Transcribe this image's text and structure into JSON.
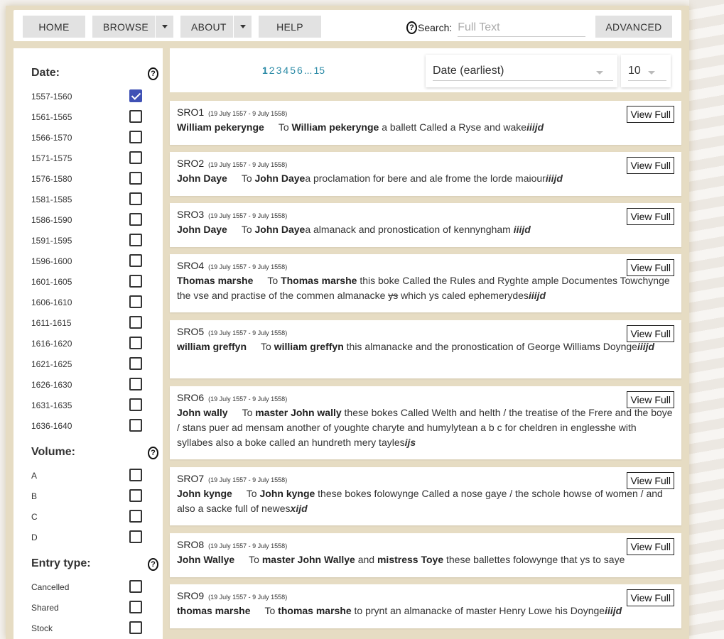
{
  "nav": {
    "home": "HOME",
    "browse": "BROWSE",
    "about": "ABOUT",
    "help": "HELP",
    "help_mark": "?",
    "search_label": "Search:",
    "search_placeholder": "Full Text",
    "advanced": "ADVANCED"
  },
  "filters": {
    "help_mark": "?",
    "date": {
      "title": "Date:",
      "items": [
        {
          "label": "1557-1560",
          "checked": true
        },
        {
          "label": "1561-1565",
          "checked": false
        },
        {
          "label": "1566-1570",
          "checked": false
        },
        {
          "label": "1571-1575",
          "checked": false
        },
        {
          "label": "1576-1580",
          "checked": false
        },
        {
          "label": "1581-1585",
          "checked": false
        },
        {
          "label": "1586-1590",
          "checked": false
        },
        {
          "label": "1591-1595",
          "checked": false
        },
        {
          "label": "1596-1600",
          "checked": false
        },
        {
          "label": "1601-1605",
          "checked": false
        },
        {
          "label": "1606-1610",
          "checked": false
        },
        {
          "label": "1611-1615",
          "checked": false
        },
        {
          "label": "1616-1620",
          "checked": false
        },
        {
          "label": "1621-1625",
          "checked": false
        },
        {
          "label": "1626-1630",
          "checked": false
        },
        {
          "label": "1631-1635",
          "checked": false
        },
        {
          "label": "1636-1640",
          "checked": false
        }
      ]
    },
    "volume": {
      "title": "Volume:",
      "items": [
        {
          "label": "A",
          "checked": false
        },
        {
          "label": "B",
          "checked": false
        },
        {
          "label": "C",
          "checked": false
        },
        {
          "label": "D",
          "checked": false
        }
      ]
    },
    "entry_type": {
      "title": "Entry type:",
      "items": [
        {
          "label": "Cancelled",
          "checked": false
        },
        {
          "label": "Shared",
          "checked": false
        },
        {
          "label": "Stock",
          "checked": false
        }
      ]
    }
  },
  "pager": {
    "pages": [
      "1",
      "2",
      "3",
      "4",
      "5",
      "6",
      "...",
      "15"
    ],
    "current": "1",
    "sort": "Date (earliest)",
    "per_page": "10"
  },
  "results": {
    "view_label": "View Full",
    "items": [
      {
        "id": "SRO1",
        "date": "(19 July 1557 - 9 July 1558)",
        "html": "<b>William pekerynge</b><span class=\"gap\"></span>To <b>William pekerynge</b> a ballett Called a Ryse and wake<span class=\"fee\">iiijd</span>"
      },
      {
        "id": "SRO2",
        "date": "(19 July 1557 - 9 July 1558)",
        "html": "<b>John Daye</b><span class=\"gap\"></span>To <b>John Daye</b>a proclamation for bere and ale frome the lorde maiour<span class=\"fee\">iiijd</span>"
      },
      {
        "id": "SRO3",
        "date": "(19 July 1557 - 9 July 1558)",
        "html": "<b>John Daye</b><span class=\"gap\"></span>To <b>John Daye</b>a almanack and pronostication of kennyngham <span class=\"fee\">iiijd</span>"
      },
      {
        "id": "SRO4",
        "date": "(19 July 1557 - 9 July 1558)",
        "html": "<b>Thomas marshe</b><span class=\"gap\"></span>To <b>Thomas marshe</b> this boke Called the Rules and Ryghte ample Documentes Towchynge the vse and practise of the commen almanacke <span class=\"strike\">ys</span> which ys caled ephemerydes<span class=\"fee\">iiijd</span>"
      },
      {
        "id": "SRO5",
        "date": "(19 July 1557 - 9 July 1558)",
        "html": "<b>william greffyn</b><span class=\"gap\"></span>To <b>william greffyn</b> this almanacke and the pronostication of George Williams Doynge<span class=\"fee\">iiijd</span>"
      },
      {
        "id": "SRO6",
        "date": "(19 July 1557 - 9 July 1558)",
        "html": "<b>John wally</b><span class=\"gap\"></span>To <b>master John wally</b> these bokes Called Welth and helth / the treatise of the Frere and the boye / stans puer ad mensam another of youghte charyte and humylytean a b c for cheldren in englesshe with syllabes also a boke called an hundreth mery tayles<span class=\"fee\">ijs</span>"
      },
      {
        "id": "SRO7",
        "date": "(19 July 1557 - 9 July 1558)",
        "html": "<b>John kynge</b><span class=\"gap\"></span>To <b>John kynge</b> these bokes folowynge Called a nose gaye / the schole howse of women / and also a sacke full of newes<span class=\"fee\">xijd</span>"
      },
      {
        "id": "SRO8",
        "date": "(19 July 1557 - 9 July 1558)",
        "html": "<b>John Wallye</b><span class=\"gap\"></span>To <b>master John Wallye</b> and <b>mistress Toye</b> these ballettes folowynge that ys to saye"
      },
      {
        "id": "SRO9",
        "date": "(19 July 1557 - 9 July 1558)",
        "html": "<b>thomas marshe</b><span class=\"gap\"></span>To <b>thomas marshe</b> to prynt an almanacke of master Henry Lowe his Doynge<span class=\"fee\">iiijd</span>"
      }
    ]
  }
}
